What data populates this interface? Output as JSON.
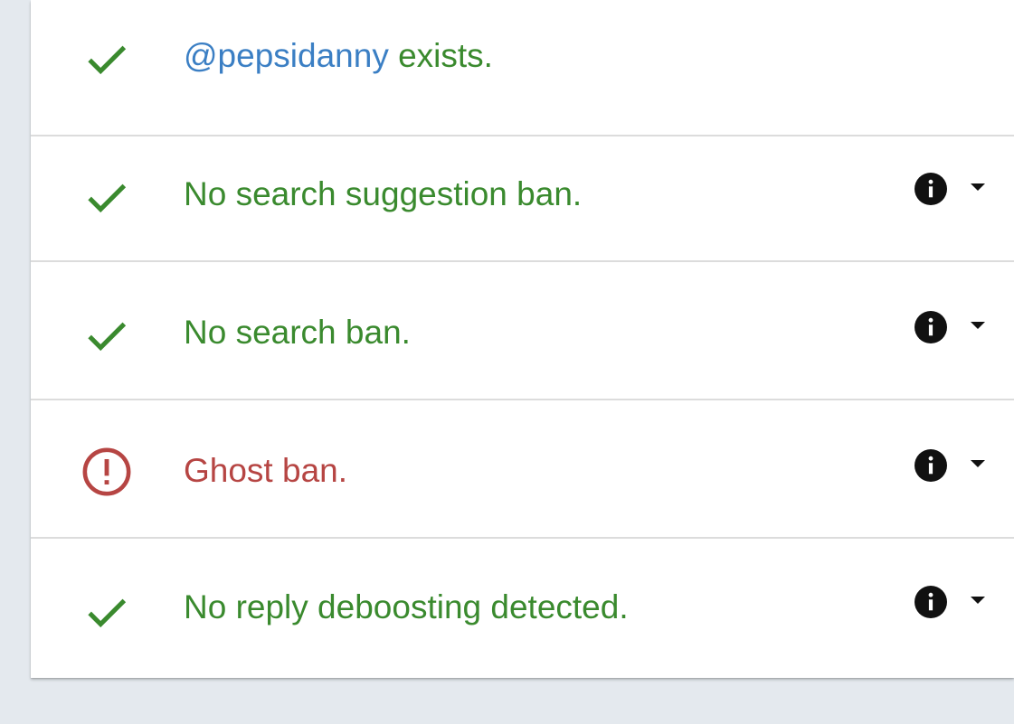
{
  "colors": {
    "ok": "#3a8a2e",
    "ban": "#b64543",
    "handle": "#3b7fc4",
    "info": "#111111"
  },
  "results": [
    {
      "status": "ok",
      "icon": "checkmark-icon",
      "handle": "@pepsidanny",
      "text": " exists.",
      "has_info": false
    },
    {
      "status": "ok",
      "icon": "checkmark-icon",
      "text": "No search suggestion ban.",
      "has_info": true
    },
    {
      "status": "ok",
      "icon": "checkmark-icon",
      "text": "No search ban.",
      "has_info": true
    },
    {
      "status": "ban",
      "icon": "alert-circle-icon",
      "text": "Ghost ban.",
      "has_info": true
    },
    {
      "status": "ok",
      "icon": "checkmark-icon",
      "text": "No reply deboosting detected.",
      "has_info": true
    }
  ]
}
